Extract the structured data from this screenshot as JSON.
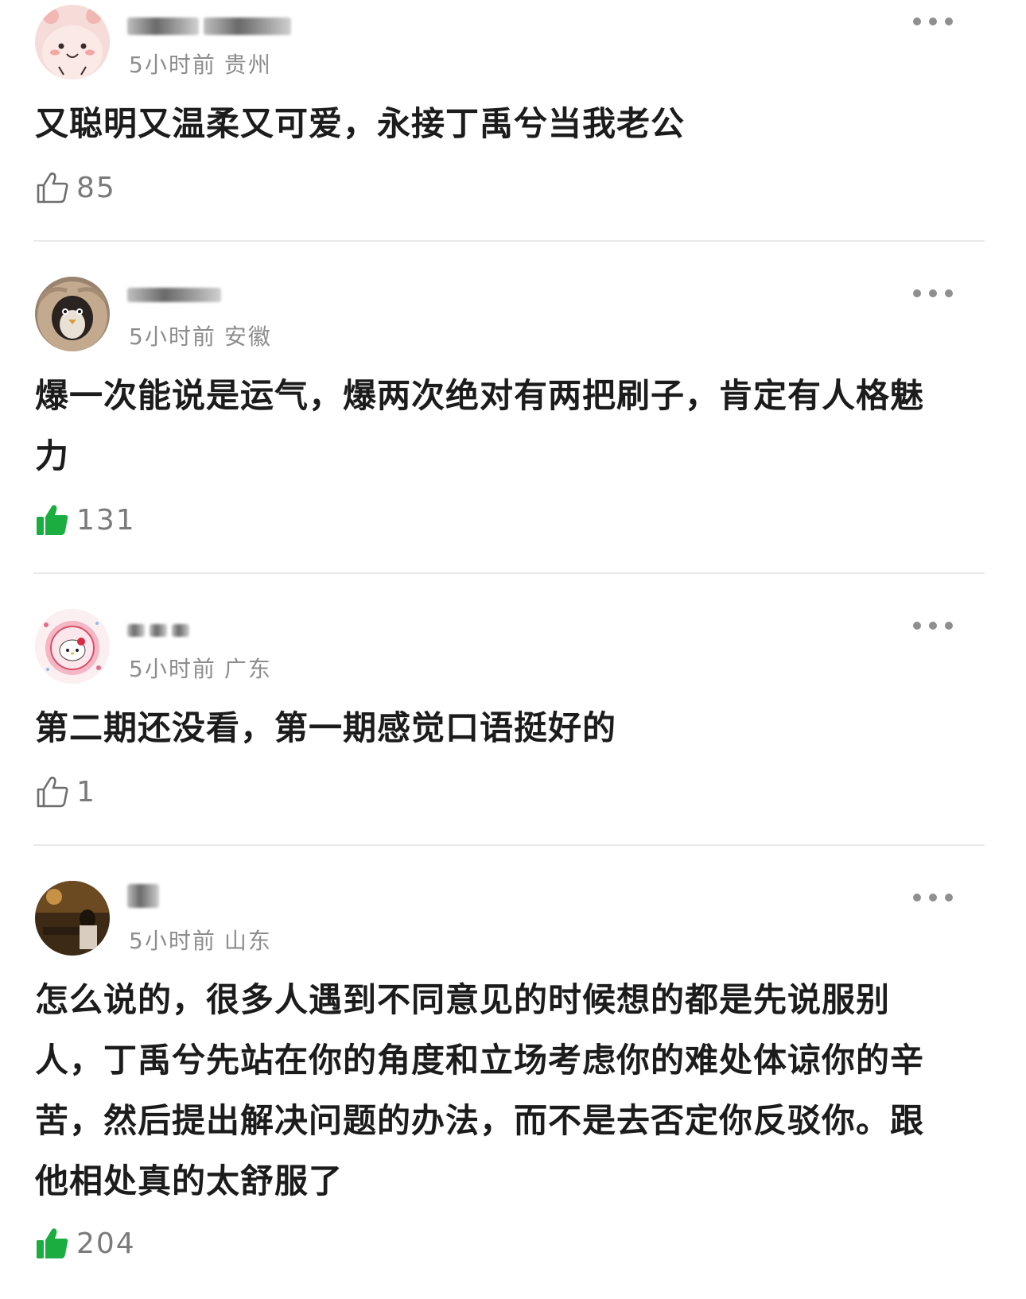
{
  "comments": [
    {
      "time": "5小时前",
      "location": "贵州",
      "text": "又聪明又温柔又可爱，永接丁禹兮当我老公",
      "likes": "85",
      "liked": false,
      "avatar_icon": "pink-cartoon-avatar-icon"
    },
    {
      "time": "5小时前",
      "location": "安徽",
      "text": "爆一次能说是运气，爆两次绝对有两把刷子，肯定有人格魅力",
      "likes": "131",
      "liked": true,
      "avatar_icon": "penguin-avatar-icon"
    },
    {
      "time": "5小时前",
      "location": "广东",
      "text": "第二期还没看，第一期感觉口语挺好的",
      "likes": "1",
      "liked": false,
      "avatar_icon": "hello-kitty-avatar-icon"
    },
    {
      "time": "5小时前",
      "location": "山东",
      "text": "怎么说的，很多人遇到不同意见的时候想的都是先说服别人，丁禹兮先站在你的角度和立场考虑你的难处体谅你的辛苦，然后提出解决问题的办法，而不是去否定你反驳你。跟他相处真的太舒服了",
      "likes": "204",
      "liked": true,
      "avatar_icon": "photo-avatar-icon"
    }
  ],
  "colors": {
    "liked_green": "#1aad3f",
    "meta_gray": "#8d8d8d",
    "text": "#1c1c1c"
  }
}
